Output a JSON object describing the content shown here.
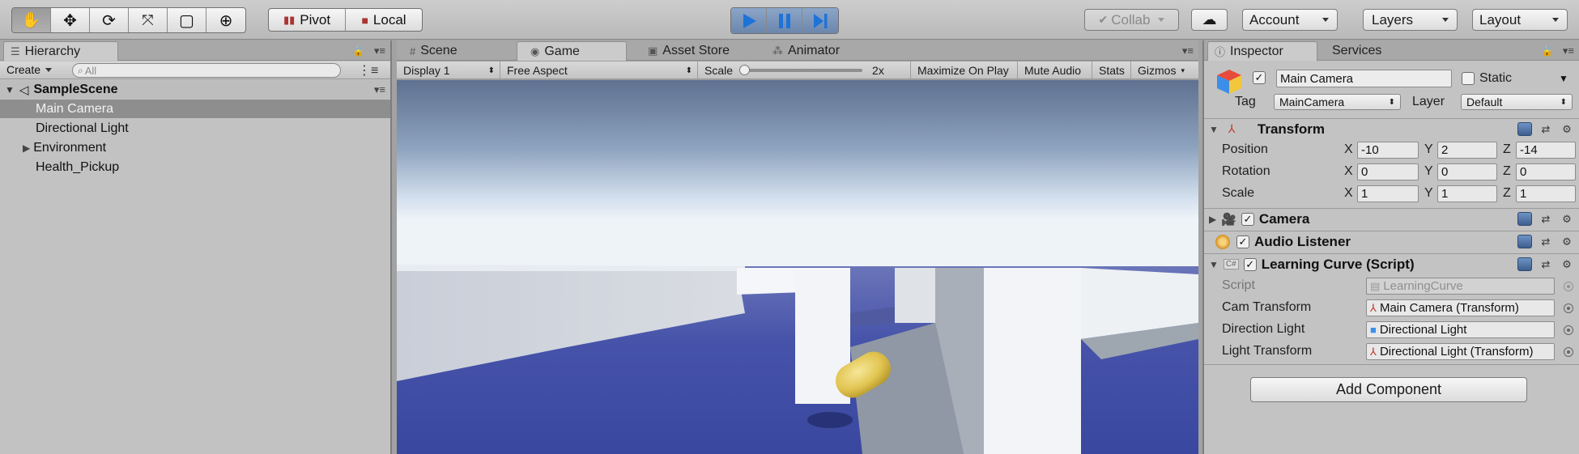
{
  "toolbar": {
    "tools": [
      {
        "name": "hand-tool",
        "icon": "✋"
      },
      {
        "name": "move-tool",
        "icon": "✥"
      },
      {
        "name": "rotate-tool",
        "icon": "⟳"
      },
      {
        "name": "scale-tool",
        "icon": "⤧"
      },
      {
        "name": "rect-tool",
        "icon": "▢"
      },
      {
        "name": "transform-tool",
        "icon": "⊕"
      }
    ],
    "pivot_label": "Pivot",
    "local_label": "Local",
    "collab_label": "Collab",
    "account_label": "Account",
    "layers_label": "Layers",
    "layout_label": "Layout"
  },
  "hierarchy": {
    "tab_label": "Hierarchy",
    "create_label": "Create",
    "search_placeholder": "All",
    "scene_name": "SampleScene",
    "items": [
      {
        "label": "Main Camera",
        "selected": true,
        "foldout": false
      },
      {
        "label": "Directional Light",
        "selected": false,
        "foldout": false
      },
      {
        "label": "Environment",
        "selected": false,
        "foldout": true
      },
      {
        "label": "Health_Pickup",
        "selected": false,
        "foldout": false
      }
    ]
  },
  "center": {
    "tabs": [
      {
        "label": "Scene",
        "icon": "#"
      },
      {
        "label": "Game",
        "icon": "◉",
        "active": true
      },
      {
        "label": "Asset Store",
        "icon": "🛍"
      },
      {
        "label": "Animator",
        "icon": "⁂"
      }
    ],
    "game_toolbar": {
      "display": "Display 1",
      "aspect": "Free Aspect",
      "scale_label": "Scale",
      "scale_value": "2x",
      "maximize": "Maximize On Play",
      "mute": "Mute Audio",
      "stats": "Stats",
      "gizmos": "Gizmos"
    }
  },
  "inspector": {
    "tab_label": "Inspector",
    "services_label": "Services",
    "object_name": "Main Camera",
    "static_label": "Static",
    "tag_label": "Tag",
    "tag_value": "MainCamera",
    "layer_label": "Layer",
    "layer_value": "Default",
    "transform": {
      "title": "Transform",
      "rows": [
        {
          "label": "Position",
          "x": "-10",
          "y": "2",
          "z": "-14"
        },
        {
          "label": "Rotation",
          "x": "0",
          "y": "0",
          "z": "0"
        },
        {
          "label": "Scale",
          "x": "1",
          "y": "1",
          "z": "1"
        }
      ]
    },
    "components": [
      {
        "title": "Camera"
      },
      {
        "title": "Audio Listener"
      }
    ],
    "script_component": {
      "title": "Learning Curve (Script)",
      "fields": [
        {
          "label": "Script",
          "value": "LearningCurve",
          "disabled": true
        },
        {
          "label": "Cam Transform",
          "value": "Main Camera (Transform)"
        },
        {
          "label": "Direction Light",
          "value": "Directional Light"
        },
        {
          "label": "Light Transform",
          "value": "Directional Light (Transform)"
        }
      ]
    },
    "add_component_label": "Add Component"
  },
  "colors": {
    "play_blue": "#1e73d8",
    "toolbar_bg": "#c4c4c4",
    "sky_top": "#5f7191",
    "sky_horizon": "#eef3f8",
    "ground": "#3f4ba6",
    "capsule": "#e2c552"
  }
}
